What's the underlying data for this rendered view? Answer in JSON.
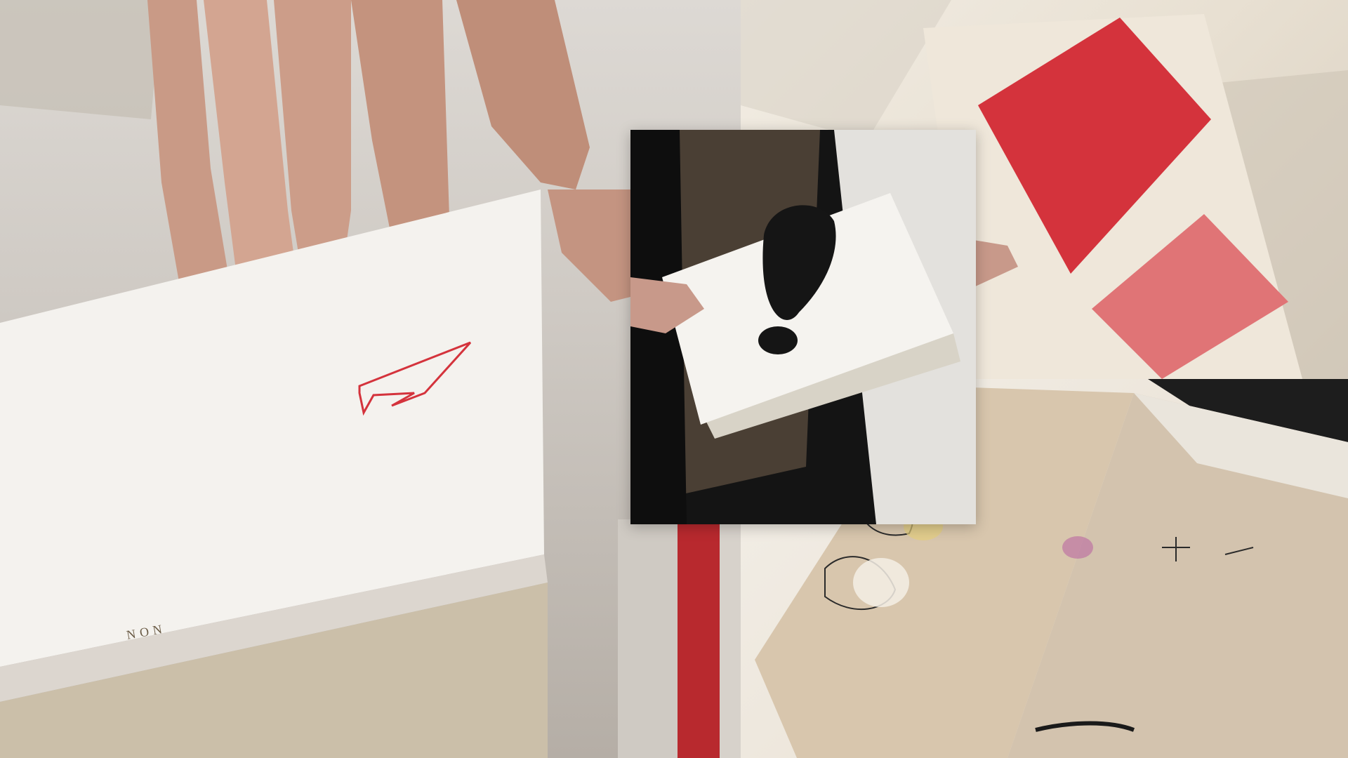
{
  "collage": {
    "panels": [
      {
        "name": "hands-white-card-heart"
      },
      {
        "name": "red-print-sunlit-spread"
      },
      {
        "name": "sketchbook-spread"
      },
      {
        "name": "black-white-cutout-book"
      }
    ]
  },
  "colors": {
    "accent_red": "#d4333c",
    "paper_white": "#f5f3ef",
    "kraft": "#d8c6ad",
    "ink": "#1a1a1a"
  },
  "card": {
    "spine_text": "NON"
  }
}
